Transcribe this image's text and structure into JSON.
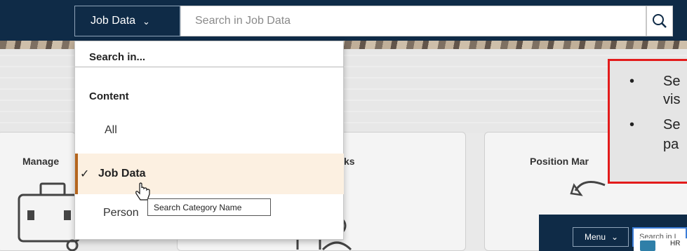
{
  "header": {
    "category_label": "Job Data",
    "search_placeholder": "Search in Job Data"
  },
  "dropdown": {
    "heading": "Search in...",
    "section": "Content",
    "options": [
      {
        "label": "All",
        "selected": false
      },
      {
        "label": "Job Data",
        "selected": true
      },
      {
        "label": "Person",
        "selected": false
      }
    ],
    "tooltip": "Search Category Name"
  },
  "tiles": {
    "tile1_title": "Manage",
    "tile2_title": "ks",
    "tile3_title": "Position Mar"
  },
  "callout": {
    "line1": "Se",
    "line2": "vis",
    "line3": "Se",
    "line4": "pa"
  },
  "inset": {
    "menu_label": "Menu",
    "search_text": "Search in I",
    "row_text": "HR"
  },
  "colors": {
    "header_bg": "#0f2b47",
    "selected_bg": "#fcf0e1",
    "selected_accent": "#b5651d",
    "callout_border": "#e31b1b"
  }
}
